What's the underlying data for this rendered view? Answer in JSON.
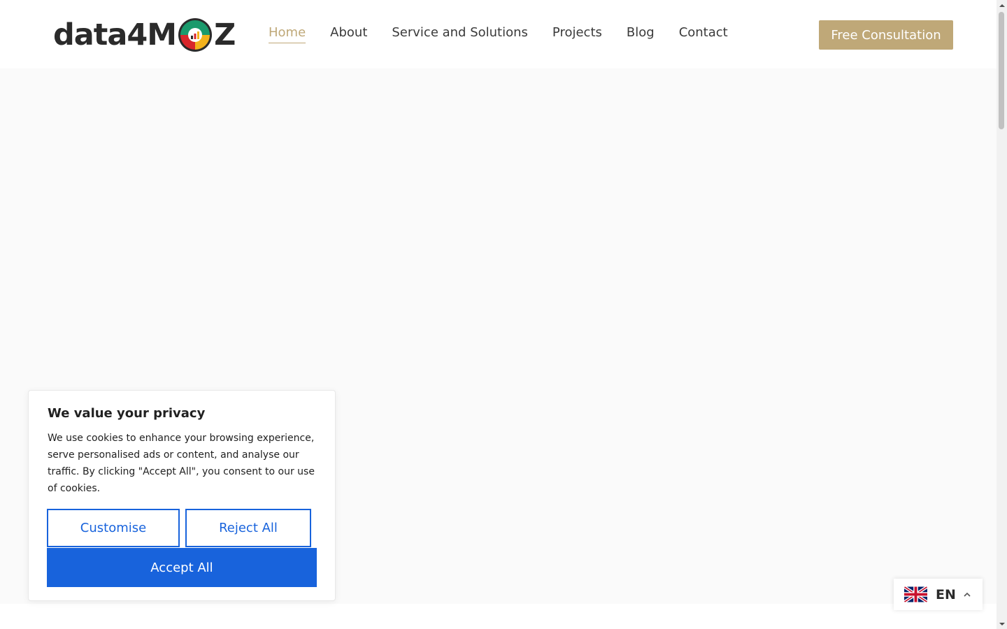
{
  "logo": {
    "text_left": "data4M",
    "text_right": "Z",
    "colors": {
      "text": "#2b2b2b",
      "green": "#1a9a6c",
      "yellow": "#f3b21c",
      "red": "#d8262b"
    }
  },
  "nav": {
    "items": [
      {
        "label": "Home",
        "active": true
      },
      {
        "label": "About"
      },
      {
        "label": "Service and Solutions"
      },
      {
        "label": "Projects"
      },
      {
        "label": "Blog"
      },
      {
        "label": "Contact"
      }
    ],
    "accent": "#bfa878"
  },
  "cta": {
    "label": "Free Consultation"
  },
  "cookie": {
    "title": "We value your privacy",
    "text": "We use cookies to enhance your browsing experience, serve personalised ads or content, and analyse our traffic. By clicking \"Accept All\", you consent to our use of cookies.",
    "customise_label": "Customise",
    "reject_label": "Reject All",
    "accept_label": "Accept All",
    "accent": "#1863dc"
  },
  "language": {
    "label": "EN",
    "flag_icon": "uk-flag-icon",
    "chevron_icon": "chevron-up-icon"
  }
}
